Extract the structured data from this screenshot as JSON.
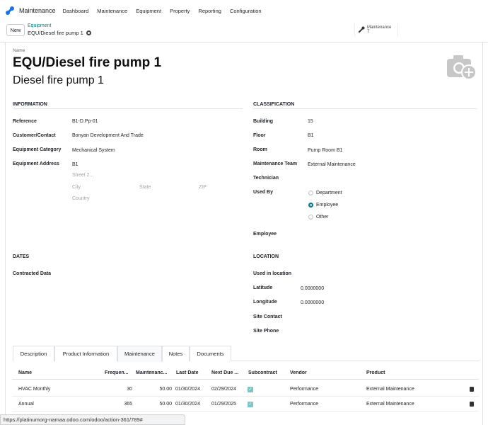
{
  "app": {
    "name": "Maintenance"
  },
  "nav": [
    "Dashboard",
    "Maintenance",
    "Equipment",
    "Property",
    "Reporting",
    "Configuration"
  ],
  "control": {
    "new_label": "New",
    "breadcrumb_parent": "Equipment",
    "breadcrumb_current": "EQU/Diesel fire pump 1",
    "smart_label": "Maintenance",
    "smart_count": "7"
  },
  "sheet": {
    "name_label": "Name",
    "title": "EQU/Diesel fire pump 1",
    "subtitle": "Diesel fire pump 1"
  },
  "information": {
    "heading": "INFORMATION",
    "reference_label": "Reference",
    "reference": "B1-D.Pp-01",
    "customer_label": "Customer/Contact",
    "customer": "Bonyan Development And Trade",
    "category_label": "Equipment Category",
    "category": "Mechanical System",
    "address_label": "Equipment Address",
    "address": "B1",
    "street2_ph": "Street 2...",
    "city_ph": "City",
    "state_ph": "State",
    "zip_ph": "ZIP",
    "country_ph": "Country"
  },
  "classification": {
    "heading": "CLASSIFICATION",
    "building_label": "Building",
    "building": "15",
    "floor_label": "Floor",
    "floor": "B1",
    "room_label": "Room",
    "room": "Pump Room B1",
    "team_label": "Maintenance Team",
    "team": "External Maintenance",
    "technician_label": "Technician",
    "used_by_label": "Used By",
    "used_by_options": [
      "Department",
      "Employee",
      "Other"
    ],
    "used_by_selected": "Employee",
    "employee_label": "Employee"
  },
  "dates": {
    "heading": "DATES",
    "contracted_label": "Contracted Data"
  },
  "location": {
    "heading": "LOCATION",
    "used_in_label": "Used in location",
    "latitude_label": "Latitude",
    "latitude": "0.0000000",
    "longitude_label": "Longitude",
    "longitude": "0.0000000",
    "site_contact_label": "Site Contact",
    "site_phone_label": "Site Phone"
  },
  "tabs": [
    "Description",
    "Product Information",
    "Maintenance",
    "Notes",
    "Documents"
  ],
  "active_tab": "Maintenance",
  "table": {
    "headers": [
      "Name",
      "Frequen...",
      "Maintenanc...",
      "Last Date",
      "Next Due ...",
      "Subcontract",
      "Vendor",
      "Product"
    ],
    "rows": [
      {
        "name": "HVAC Monthly",
        "frequency": "30",
        "maintenance": "50.00",
        "last_date": "01/30/2024",
        "next_due": "02/29/2024",
        "subcontract": true,
        "vendor": "Performance",
        "product": "External Maintenance"
      },
      {
        "name": "Annual",
        "frequency": "365",
        "maintenance": "50.00",
        "last_date": "01/30/2024",
        "next_due": "01/29/2025",
        "subcontract": true,
        "vendor": "Performance",
        "product": "External Maintenance"
      }
    ]
  },
  "status_url": "https://platinumorg-namaa.odoo.com/odoo/action-361/789#",
  "colors": {
    "accent": "#017e84",
    "brand": "#714b67"
  }
}
